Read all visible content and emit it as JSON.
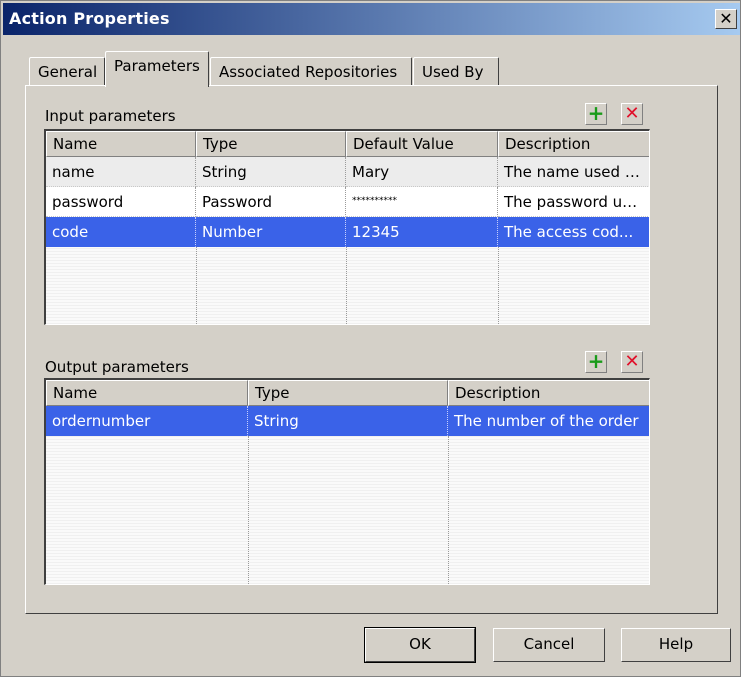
{
  "window": {
    "title": "Action Properties",
    "close_glyph": "✕"
  },
  "tabs": [
    {
      "label": "General"
    },
    {
      "label": "Parameters"
    },
    {
      "label": "Associated Repositories"
    },
    {
      "label": "Used By"
    }
  ],
  "input_parameters": {
    "label": "Input parameters",
    "add_glyph": "+",
    "delete_glyph": "✕",
    "columns": [
      "Name",
      "Type",
      "Default Value",
      "Description"
    ],
    "rows": [
      [
        "name",
        "String",
        "Mary",
        "The name used t..."
      ],
      [
        "password",
        "Password",
        "**********",
        "The password us..."
      ],
      [
        "code",
        "Number",
        "12345",
        "The access cod..."
      ]
    ],
    "selected_row": 2
  },
  "output_parameters": {
    "label": "Output parameters",
    "add_glyph": "+",
    "delete_glyph": "✕",
    "columns": [
      "Name",
      "Type",
      "Description"
    ],
    "rows": [
      [
        "ordernumber",
        "String",
        "The number of the order"
      ]
    ],
    "selected_row": 0
  },
  "buttons": {
    "ok": "OK",
    "cancel": "Cancel",
    "help": "Help"
  },
  "colors": {
    "title_gradient_start": "#0a246a",
    "selection": "#3a62e8",
    "add_icon": "#1a9b1a",
    "delete_icon": "#e0102a"
  }
}
